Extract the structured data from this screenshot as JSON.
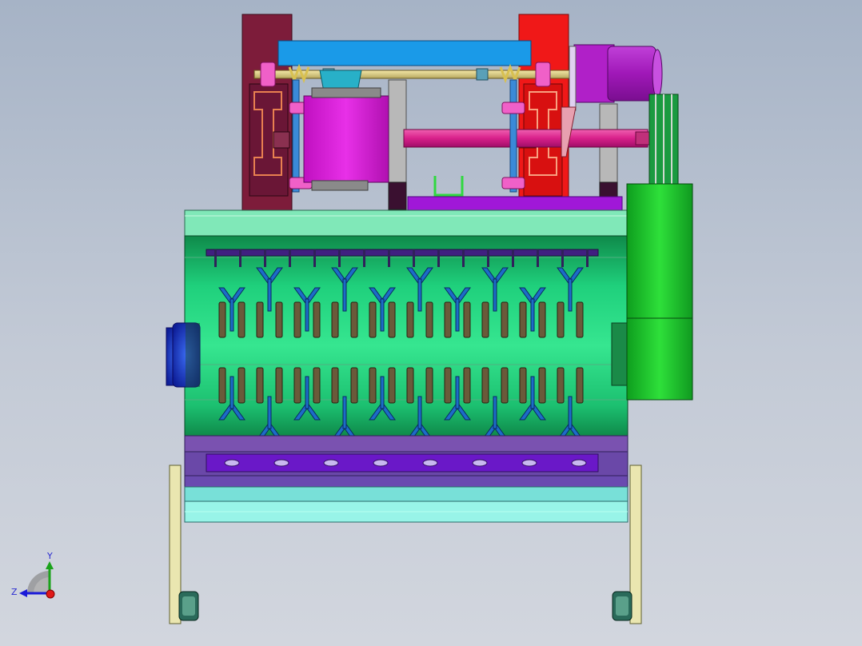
{
  "view": {
    "background_top": "#a6b3c6",
    "background_bottom": "#d2d6de"
  },
  "triad": {
    "y_label": "Y",
    "z_label": "Z",
    "y_color": "#1aa21a",
    "z_color": "#1a1ad8",
    "x_dot_color": "#e01818"
  },
  "colors": {
    "left_column": "#7d1c3a",
    "right_column": "#f01818",
    "top_beam": "#1a9ae8",
    "gearbox": "#dc18dc",
    "motor": "#a018b8",
    "drum": "#1ed37a",
    "belt_cover": "#18b818",
    "bottom_tray": "#7a52b0",
    "legs": "#eae6b0",
    "hub": "#1a3ad8",
    "blades": "#1c6cc8",
    "teeth": "#6a5a3a"
  }
}
